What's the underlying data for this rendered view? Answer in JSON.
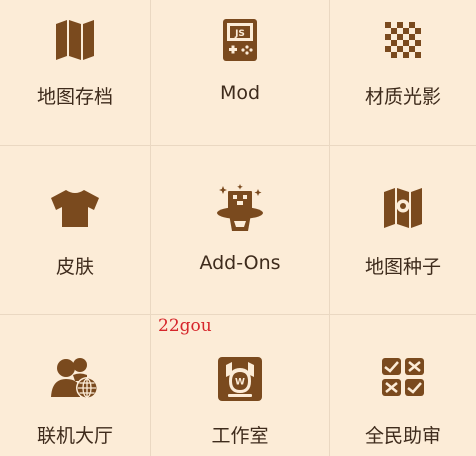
{
  "menu": {
    "items": [
      {
        "label": "地图存档",
        "icon": "map-icon"
      },
      {
        "label": "Mod",
        "icon": "js-mod-icon"
      },
      {
        "label": "材质光影",
        "icon": "checkerboard-texture-icon"
      },
      {
        "label": "皮肤",
        "icon": "shirt-icon"
      },
      {
        "label": "Add-Ons",
        "icon": "magic-hat-icon"
      },
      {
        "label": "地图种子",
        "icon": "map-seed-icon"
      },
      {
        "label": "联机大厅",
        "icon": "multiplayer-globe-icon"
      },
      {
        "label": "工作室",
        "icon": "studio-icon"
      },
      {
        "label": "全民助审",
        "icon": "review-checklist-icon"
      }
    ]
  },
  "watermark": "22gou",
  "colors": {
    "background": "#fcecd7",
    "icon": "#7a4a1e",
    "text": "#3e2b1c",
    "divider": "#ead8c2",
    "watermark": "#d6262b"
  }
}
